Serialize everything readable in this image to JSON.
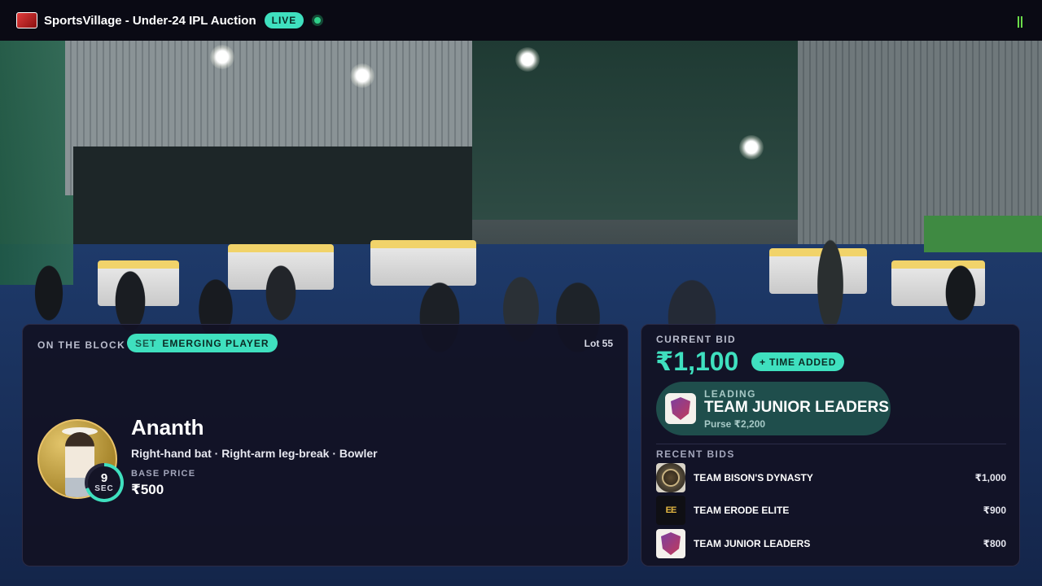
{
  "header": {
    "logo_text": "Sports Village",
    "title": "SportsVillage - Under-24 IPL Auction",
    "live_label": "LIVE"
  },
  "player_panel": {
    "on_the_block_label": "ON THE BLOCK",
    "set_prefix": "SET",
    "set_name": "EMERGING PLAYER",
    "lot": "Lot 55",
    "player_name": "Ananth",
    "player_role": "Right-hand bat · Right-arm leg-break · Bowler",
    "base_price_label": "BASE PRICE",
    "base_price": "₹500",
    "timer_value": "9",
    "timer_unit": "SEC",
    "timer_progress": 0.7
  },
  "bid_panel": {
    "current_bid_label": "CURRENT BID",
    "current_bid": "₹1,100",
    "time_added_label": "+ TIME ADDED",
    "leading_label": "LEADING",
    "leading_team": "TEAM JUNIOR LEADERS",
    "leading_purse": "Purse ₹2,200",
    "recent_bids_label": "RECENT BIDS",
    "recent_bids": [
      {
        "team": "TEAM BISON'S DYNASTY",
        "amount": "₹1,000",
        "logo_icon": "bison-logo-icon"
      },
      {
        "team": "TEAM ERODE ELITE",
        "amount": "₹900",
        "logo_icon": "erode-elite-logo-icon"
      },
      {
        "team": "TEAM JUNIOR LEADERS",
        "amount": "₹800",
        "logo_icon": "junior-leaders-shield-icon"
      }
    ]
  },
  "colors": {
    "accent": "#3fe0bf",
    "live_dot": "#2fd08a",
    "panel_bg": "#121224",
    "leading_card": "#1f4e4c"
  }
}
